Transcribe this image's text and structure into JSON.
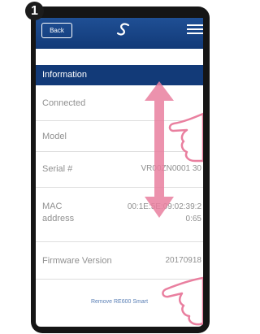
{
  "step_number": "1",
  "topbar": {
    "back_label": "Back",
    "logo_icon": "swirl-logo-icon",
    "menu_icon": "hamburger-menu-icon"
  },
  "section": {
    "title": "Information"
  },
  "rows": [
    {
      "label": "Connected",
      "value": ""
    },
    {
      "label": "Model",
      "value": ""
    },
    {
      "label": "Serial #",
      "value": "VR00ZN0001 30"
    },
    {
      "label": "MAC address",
      "value": "00:1E:5E:09:02:39:2\n0:65"
    },
    {
      "label": "Firmware Version",
      "value": "20170918"
    }
  ],
  "footer": {
    "remove_label": "Remove RE600 Smart"
  },
  "colors": {
    "header_blue": "#123a78",
    "overlay_pink": "#e97f9f",
    "text_gray": "#909090"
  },
  "overlay": {
    "gesture": "scroll-vertical",
    "arrow_icon": "double-arrow-vertical-icon",
    "hand_icons": [
      "hand-pointer-icon",
      "hand-pointer-icon"
    ]
  }
}
